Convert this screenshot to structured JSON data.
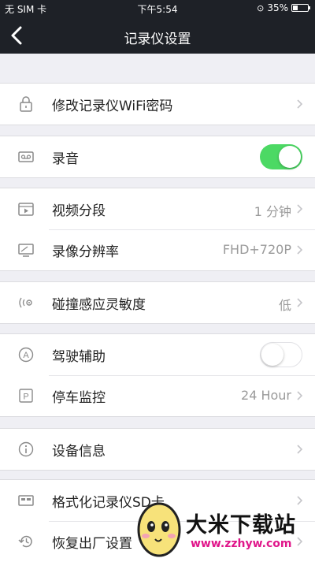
{
  "status_bar": {
    "carrier": "无 SIM 卡",
    "time": "下午5:54",
    "battery": "35%",
    "battery_level": 0.35
  },
  "nav": {
    "title": "记录仪设置",
    "back_icon": "chevron-left-icon"
  },
  "groups": [
    [
      {
        "label": "修改记录仪WiFi密码",
        "icon": "lock-icon",
        "value": ""
      }
    ],
    [
      {
        "label": "录音",
        "icon": "recorder-icon",
        "toggle": true
      }
    ],
    [
      {
        "label": "视频分段",
        "icon": "video-icon",
        "value": "1 分钟"
      },
      {
        "label": "录像分辨率",
        "icon": "monitor-icon",
        "value": "FHD+720P"
      }
    ],
    [
      {
        "label": "碰撞感应灵敏度",
        "icon": "sensor-icon",
        "value": "低"
      }
    ],
    [
      {
        "label": "驾驶辅助",
        "icon": "assist-icon",
        "toggle": false
      },
      {
        "label": "停车监控",
        "icon": "parking-icon",
        "value": "24 Hour"
      }
    ],
    [
      {
        "label": "设备信息",
        "icon": "info-icon",
        "value": ""
      }
    ],
    [
      {
        "label": "格式化记录仪SD卡",
        "icon": "sd-card-icon",
        "value": ""
      },
      {
        "label": "恢复出厂设置",
        "icon": "restore-icon",
        "value": ""
      }
    ]
  ],
  "watermark": {
    "brand": "大米下载站",
    "url": "www.zzhyw.com"
  },
  "colors": {
    "nav_bg": "#1e2127",
    "toggle_on": "#4cd964",
    "page_bg": "#efeff4"
  }
}
